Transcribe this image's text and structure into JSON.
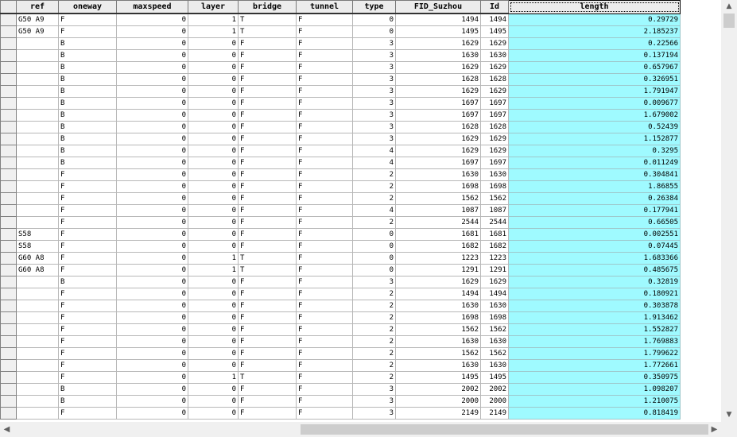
{
  "columns": [
    "ref",
    "oneway",
    "maxspeed",
    "layer",
    "bridge",
    "tunnel",
    "type",
    "FID_Suzhou",
    "Id",
    "length"
  ],
  "rows": [
    [
      "G50 A9",
      "F",
      "0",
      "1",
      "T",
      "F",
      "0",
      "1494",
      "1494",
      "0.29729"
    ],
    [
      "G50 A9",
      "F",
      "0",
      "1",
      "T",
      "F",
      "0",
      "1495",
      "1495",
      "2.185237"
    ],
    [
      "",
      "B",
      "0",
      "0",
      "F",
      "F",
      "3",
      "1629",
      "1629",
      "0.22566"
    ],
    [
      "",
      "B",
      "0",
      "0",
      "F",
      "F",
      "3",
      "1630",
      "1630",
      "0.137194"
    ],
    [
      "",
      "B",
      "0",
      "0",
      "F",
      "F",
      "3",
      "1629",
      "1629",
      "0.657967"
    ],
    [
      "",
      "B",
      "0",
      "0",
      "F",
      "F",
      "3",
      "1628",
      "1628",
      "0.326951"
    ],
    [
      "",
      "B",
      "0",
      "0",
      "F",
      "F",
      "3",
      "1629",
      "1629",
      "1.791947"
    ],
    [
      "",
      "B",
      "0",
      "0",
      "F",
      "F",
      "3",
      "1697",
      "1697",
      "0.009677"
    ],
    [
      "",
      "B",
      "0",
      "0",
      "F",
      "F",
      "3",
      "1697",
      "1697",
      "1.679002"
    ],
    [
      "",
      "B",
      "0",
      "0",
      "F",
      "F",
      "3",
      "1628",
      "1628",
      "0.52439"
    ],
    [
      "",
      "B",
      "0",
      "0",
      "F",
      "F",
      "3",
      "1629",
      "1629",
      "1.152877"
    ],
    [
      "",
      "B",
      "0",
      "0",
      "F",
      "F",
      "4",
      "1629",
      "1629",
      "0.3295"
    ],
    [
      "",
      "B",
      "0",
      "0",
      "F",
      "F",
      "4",
      "1697",
      "1697",
      "0.011249"
    ],
    [
      "",
      "F",
      "0",
      "0",
      "F",
      "F",
      "2",
      "1630",
      "1630",
      "0.304841"
    ],
    [
      "",
      "F",
      "0",
      "0",
      "F",
      "F",
      "2",
      "1698",
      "1698",
      "1.86855"
    ],
    [
      "",
      "F",
      "0",
      "0",
      "F",
      "F",
      "2",
      "1562",
      "1562",
      "0.26384"
    ],
    [
      "",
      "F",
      "0",
      "0",
      "F",
      "F",
      "4",
      "1087",
      "1087",
      "0.177941"
    ],
    [
      "",
      "F",
      "0",
      "0",
      "F",
      "F",
      "2",
      "2544",
      "2544",
      "0.66505"
    ],
    [
      "S58",
      "F",
      "0",
      "0",
      "F",
      "F",
      "0",
      "1681",
      "1681",
      "0.002551"
    ],
    [
      "S58",
      "F",
      "0",
      "0",
      "F",
      "F",
      "0",
      "1682",
      "1682",
      "0.07445"
    ],
    [
      "G60 A8",
      "F",
      "0",
      "1",
      "T",
      "F",
      "0",
      "1223",
      "1223",
      "1.683366"
    ],
    [
      "G60 A8",
      "F",
      "0",
      "1",
      "T",
      "F",
      "0",
      "1291",
      "1291",
      "0.485675"
    ],
    [
      "",
      "B",
      "0",
      "0",
      "F",
      "F",
      "3",
      "1629",
      "1629",
      "0.32819"
    ],
    [
      "",
      "F",
      "0",
      "0",
      "F",
      "F",
      "2",
      "1494",
      "1494",
      "0.180921"
    ],
    [
      "",
      "F",
      "0",
      "0",
      "F",
      "F",
      "2",
      "1630",
      "1630",
      "0.303878"
    ],
    [
      "",
      "F",
      "0",
      "0",
      "F",
      "F",
      "2",
      "1698",
      "1698",
      "1.913462"
    ],
    [
      "",
      "F",
      "0",
      "0",
      "F",
      "F",
      "2",
      "1562",
      "1562",
      "1.552827"
    ],
    [
      "",
      "F",
      "0",
      "0",
      "F",
      "F",
      "2",
      "1630",
      "1630",
      "1.769883"
    ],
    [
      "",
      "F",
      "0",
      "0",
      "F",
      "F",
      "2",
      "1562",
      "1562",
      "1.799622"
    ],
    [
      "",
      "F",
      "0",
      "0",
      "F",
      "F",
      "2",
      "1630",
      "1630",
      "1.772661"
    ],
    [
      "",
      "F",
      "0",
      "1",
      "T",
      "F",
      "2",
      "1495",
      "1495",
      "0.350975"
    ],
    [
      "",
      "B",
      "0",
      "0",
      "F",
      "F",
      "3",
      "2002",
      "2002",
      "1.098207"
    ],
    [
      "",
      "B",
      "0",
      "0",
      "F",
      "F",
      "3",
      "2000",
      "2000",
      "1.210075"
    ],
    [
      "",
      "F",
      "0",
      "0",
      "F",
      "F",
      "3",
      "2149",
      "2149",
      "0.818419"
    ]
  ],
  "scrollbar": {
    "up_icon": "chevron-up-icon",
    "down_icon": "chevron-down-icon",
    "left_icon": "chevron-left-icon",
    "right_icon": "chevron-right-icon"
  },
  "colors": {
    "selected_column": "#9ffaff",
    "header_bg": "#ececec"
  }
}
